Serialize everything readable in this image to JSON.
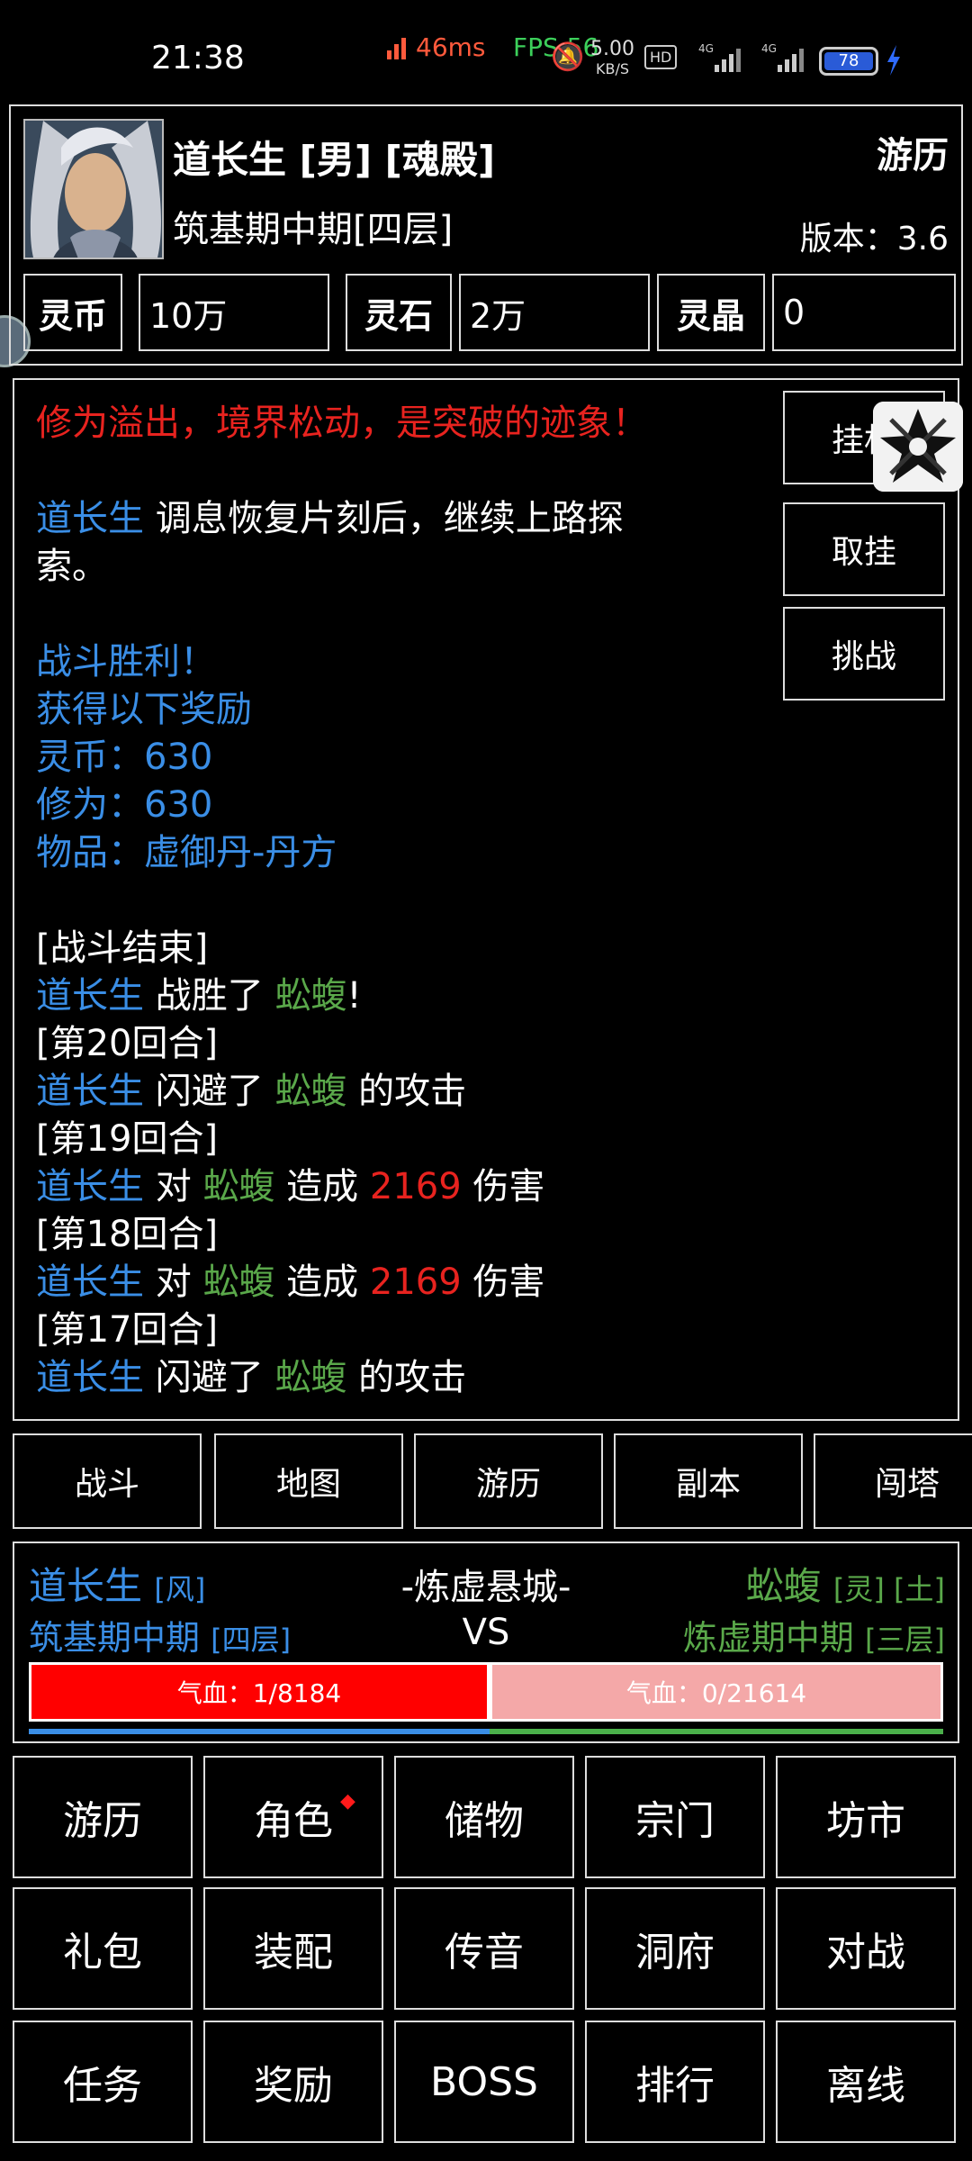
{
  "status_bar": {
    "time": "21:38",
    "ping": "46ms",
    "fps": "FPS 56",
    "net_speed": "5.00",
    "net_unit": "KB/S",
    "battery": "78",
    "icons": [
      "mute-icon",
      "hd-icon",
      "signal-4g-icon",
      "signal-4g-icon",
      "battery-icon",
      "charging-icon"
    ]
  },
  "header": {
    "name_line": "道长生 [男] [魂殿]",
    "realm": "筑基期中期[四层]",
    "travel": "游历",
    "version": "版本：3.6",
    "currencies": [
      {
        "label": "灵币",
        "value": "10万"
      },
      {
        "label": "灵石",
        "value": "2万"
      },
      {
        "label": "灵晶",
        "value": "0"
      }
    ]
  },
  "log": {
    "line1": "修为溢出，境界松动，是突破的迹象！",
    "rest_name": "道长生",
    "rest_text": " 调息恢复片刻后，继续上路探",
    "rest_text2": "索。",
    "victory": "战斗胜利！",
    "reward_title": "获得以下奖励",
    "reward_coin": "灵币：630",
    "reward_cultivation": "修为：630",
    "reward_item": "物品：虚御丹-丹方",
    "battle_end": "[战斗结束]",
    "player": "道长生",
    "enemy": "蚣蝮",
    "won_text": " 战胜了 ",
    "exclaim": "!",
    "round20": "[第20回合]",
    "dodged_text": " 闪避了 ",
    "attack_text": " 的攻击",
    "round19": "[第19回合]",
    "to_text": " 对 ",
    "deal_text": " 造成 ",
    "damage": "2169",
    "harm_text": " 伤害",
    "round18": "[第18回合]",
    "round17": "[第17回合]"
  },
  "actions": {
    "idle": "挂机",
    "cancel_idle": "取挂",
    "challenge": "挑战"
  },
  "tabs": [
    "战斗",
    "地图",
    "游历",
    "副本",
    "闯塔"
  ],
  "battle": {
    "player_name": "道长生",
    "player_element": "[风]",
    "player_realm": "筑基期中期",
    "player_layer": "[四层]",
    "location": "-炼虚悬城-",
    "vs": "VS",
    "enemy_name": "蚣蝮",
    "enemy_tags": "[灵] [土]",
    "enemy_realm": "炼虚期中期",
    "enemy_layer": "[三层]",
    "player_hp": "气血：1/8184",
    "enemy_hp": "气血：0/21614"
  },
  "menu": [
    "游历",
    "角色",
    "储物",
    "宗门",
    "坊市",
    "礼包",
    "装配",
    "传音",
    "洞府",
    "对战",
    "任务",
    "奖励",
    "BOSS",
    "排行",
    "离线"
  ],
  "colors": {
    "player": "#3a8ee6",
    "enemy": "#5aa84a",
    "damage": "#e8231f",
    "warning": "#e8231f"
  }
}
